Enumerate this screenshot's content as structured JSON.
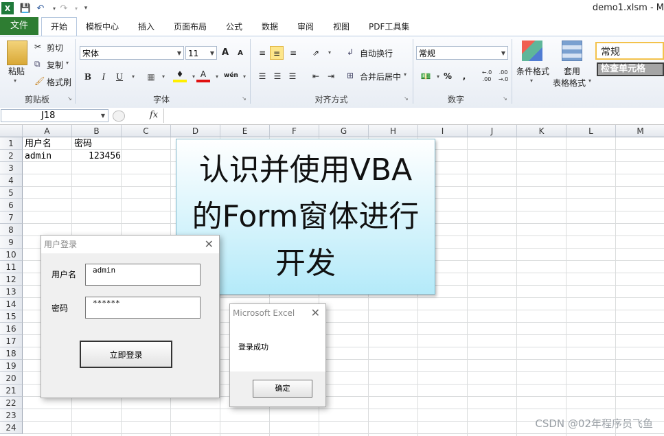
{
  "window": {
    "title": "demo1.xlsm - M"
  },
  "tabs": [
    "文件",
    "开始",
    "模板中心",
    "插入",
    "页面布局",
    "公式",
    "数据",
    "审阅",
    "视图",
    "PDF工具集"
  ],
  "ribbon": {
    "clipboard": {
      "paste": "粘贴",
      "cut": "剪切",
      "copy": "复制",
      "format_painter": "格式刷",
      "label": "剪贴板"
    },
    "font": {
      "name": "宋体",
      "size": "11",
      "bold": "B",
      "italic": "I",
      "underline": "U",
      "label": "字体",
      "grow": "A",
      "shrink": "A",
      "font_color": "A",
      "wen": "wén"
    },
    "alignment": {
      "wrap": "自动换行",
      "merge": "合并后居中",
      "label": "对齐方式"
    },
    "number": {
      "format": "常规",
      "percent": "%",
      "comma": ",",
      "inc": "←.0 .00",
      "dec": ".00 →.0",
      "label": "数字"
    },
    "styles": {
      "conditional": "条件格式",
      "table1": "套用",
      "table2": "表格格式",
      "style_normal": "常规",
      "style_check": "检查单元格"
    }
  },
  "formula_bar": {
    "name_box": "J18",
    "fx": "fx",
    "value": ""
  },
  "grid": {
    "columns": [
      "A",
      "B",
      "C",
      "D",
      "E",
      "F",
      "G",
      "H",
      "I",
      "J",
      "K",
      "L",
      "M"
    ],
    "rows": [
      "1",
      "2",
      "3",
      "4",
      "5",
      "6",
      "7",
      "8",
      "9",
      "10",
      "11",
      "12",
      "13",
      "14",
      "15",
      "16",
      "17",
      "18",
      "19",
      "20",
      "21",
      "22",
      "23",
      "24"
    ],
    "cells": {
      "A1": "用户名",
      "B1": "密码",
      "A2": "admin",
      "B2": "123456"
    }
  },
  "shape": {
    "text": "认识并使用VBA的Form窗体进行开发"
  },
  "login_dialog": {
    "title": "用户登录",
    "username_label": "用户名",
    "username_value": "admin",
    "password_label": "密码",
    "password_value": "******",
    "login_button": "立即登录"
  },
  "message_box": {
    "title": "Microsoft Excel",
    "message": "登录成功",
    "ok_button": "确定"
  },
  "watermark": "CSDN @02年程序员飞鱼"
}
